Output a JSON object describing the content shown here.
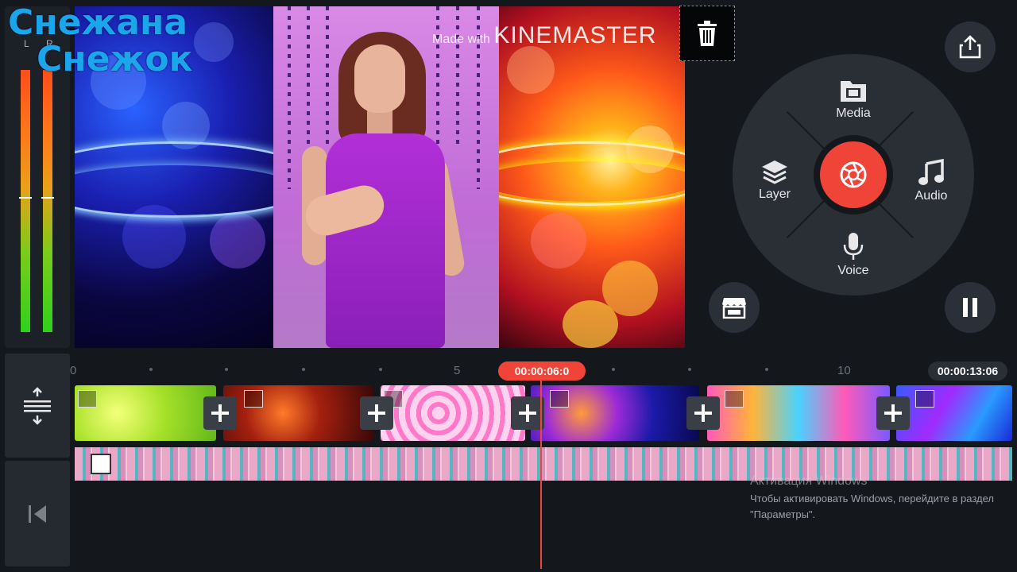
{
  "overlay": {
    "line1": "Снежана",
    "line2": "Снежок"
  },
  "meter": {
    "left_label": "L",
    "right_label": "R"
  },
  "watermark": {
    "made_with": "Made with",
    "brand": "KINEMASTER"
  },
  "wheel": {
    "media_label": "Media",
    "layer_label": "Layer",
    "audio_label": "Audio",
    "voice_label": "Voice"
  },
  "timeline": {
    "playhead_time": "00:00:06:0",
    "total_time": "00:00:13:06",
    "ruler_labels": [
      "0",
      "5",
      "10"
    ]
  },
  "activation": {
    "title": "Активация Windows",
    "text": "Чтобы активировать Windows, перейдите в раздел \"Параметры\"."
  },
  "colors": {
    "accent": "#f04438",
    "panel": "#2a2e35",
    "overlay_text": "#19a6ea"
  }
}
